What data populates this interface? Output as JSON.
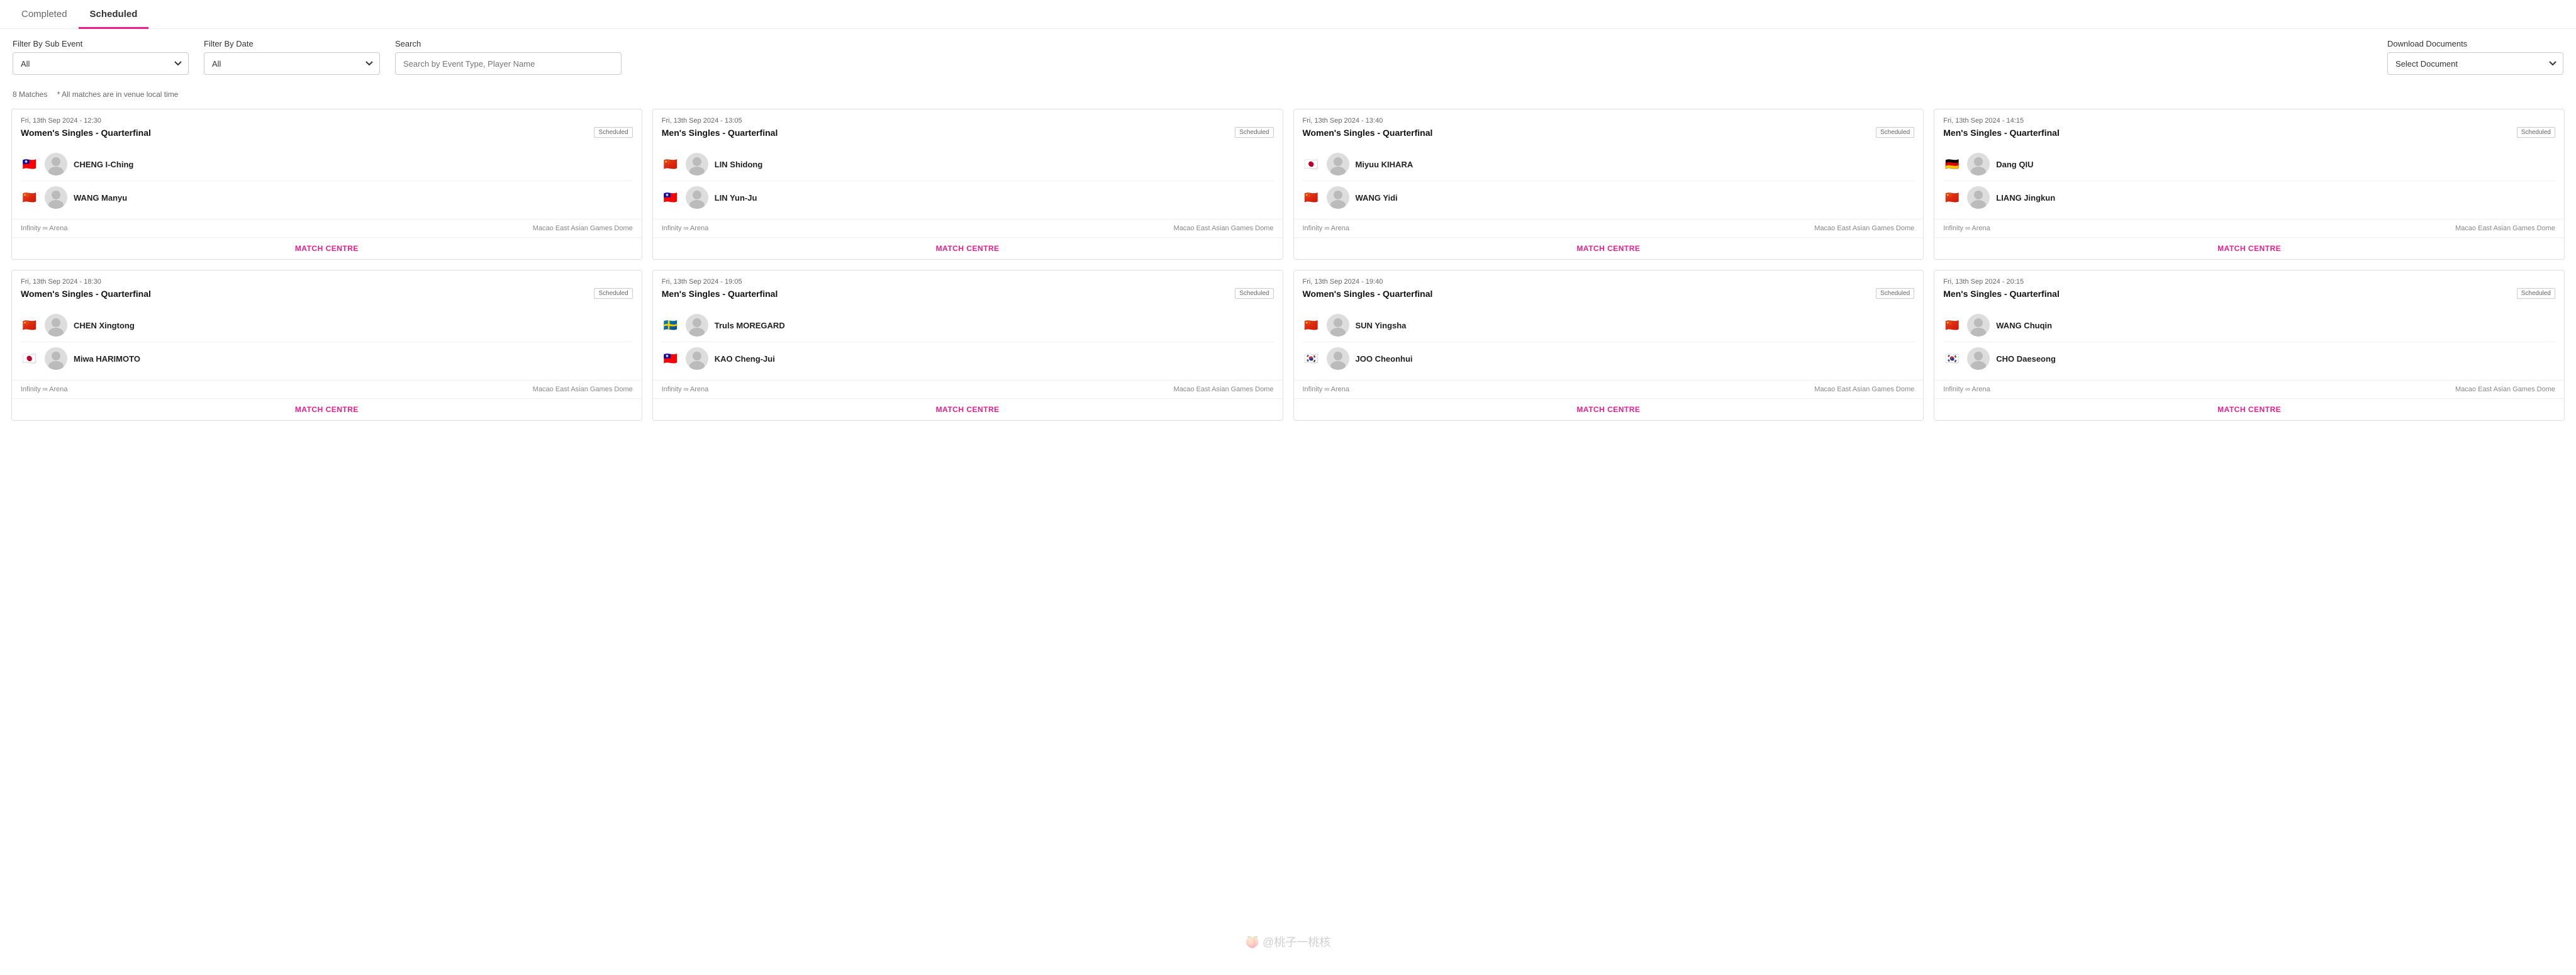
{
  "tabs": [
    {
      "id": "completed",
      "label": "Completed",
      "active": false
    },
    {
      "id": "scheduled",
      "label": "Scheduled",
      "active": true
    }
  ],
  "filters": {
    "sub_event": {
      "label": "Filter By Sub Event",
      "value": "All",
      "options": [
        "All"
      ]
    },
    "date": {
      "label": "Filter By Date",
      "value": "All",
      "options": [
        "All"
      ]
    },
    "search": {
      "label": "Search",
      "placeholder": "Search by Event Type, Player Name",
      "value": ""
    },
    "download": {
      "label": "Download Documents",
      "placeholder": "Select Document",
      "options": [
        "Select Document"
      ]
    }
  },
  "matches_info": {
    "count_label": "8 Matches",
    "note": "* All matches are in venue local time"
  },
  "matches": [
    {
      "datetime": "Fri, 13th Sep 2024 - 12:30",
      "title": "Women's Singles - Quarterfinal",
      "status": "Scheduled",
      "players": [
        {
          "flag": "🇹🇼",
          "name": "CHENG I-Ching"
        },
        {
          "flag": "🇨🇳",
          "name": "WANG Manyu"
        }
      ],
      "venue": "Infinity ∞ Arena",
      "location": "Macao East Asian Games Dome"
    },
    {
      "datetime": "Fri, 13th Sep 2024 - 13:05",
      "title": "Men's Singles - Quarterfinal",
      "status": "Scheduled",
      "players": [
        {
          "flag": "🇨🇳",
          "name": "LIN Shidong"
        },
        {
          "flag": "🇹🇼",
          "name": "LIN Yun-Ju"
        }
      ],
      "venue": "Infinity ∞ Arena",
      "location": "Macao East Asian Games Dome"
    },
    {
      "datetime": "Fri, 13th Sep 2024 - 13:40",
      "title": "Women's Singles - Quarterfinal",
      "status": "Scheduled",
      "players": [
        {
          "flag": "🇯🇵",
          "name": "Miyuu KIHARA"
        },
        {
          "flag": "🇨🇳",
          "name": "WANG Yidi"
        }
      ],
      "venue": "Infinity ∞ Arena",
      "location": "Macao East Asian Games Dome"
    },
    {
      "datetime": "Fri, 13th Sep 2024 - 14:15",
      "title": "Men's Singles - Quarterfinal",
      "status": "Scheduled",
      "players": [
        {
          "flag": "🇩🇪",
          "name": "Dang QIU"
        },
        {
          "flag": "🇨🇳",
          "name": "LIANG Jingkun"
        }
      ],
      "venue": "Infinity ∞ Arena",
      "location": "Macao East Asian Games Dome"
    },
    {
      "datetime": "Fri, 13th Sep 2024 - 18:30",
      "title": "Women's Singles - Quarterfinal",
      "status": "Scheduled",
      "players": [
        {
          "flag": "🇨🇳",
          "name": "CHEN Xingtong"
        },
        {
          "flag": "🇯🇵",
          "name": "Miwa HARIMOTO"
        }
      ],
      "venue": "Infinity ∞ Arena",
      "location": "Macao East Asian Games Dome"
    },
    {
      "datetime": "Fri, 13th Sep 2024 - 19:05",
      "title": "Men's Singles - Quarterfinal",
      "status": "Scheduled",
      "players": [
        {
          "flag": "🇸🇪",
          "name": "Truls MOREGARD"
        },
        {
          "flag": "🇹🇼",
          "name": "KAO Cheng-Jui"
        }
      ],
      "venue": "Infinity ∞ Arena",
      "location": "Macao East Asian Games Dome"
    },
    {
      "datetime": "Fri, 13th Sep 2024 - 19:40",
      "title": "Women's Singles - Quarterfinal",
      "status": "Scheduled",
      "players": [
        {
          "flag": "🇨🇳",
          "name": "SUN Yingsha"
        },
        {
          "flag": "🇰🇷",
          "name": "JOO Cheonhui"
        }
      ],
      "venue": "Infinity ∞ Arena",
      "location": "Macao East Asian Games Dome"
    },
    {
      "datetime": "Fri, 13th Sep 2024 - 20:15",
      "title": "Men's Singles - Quarterfinal",
      "status": "Scheduled",
      "players": [
        {
          "flag": "🇨🇳",
          "name": "WANG Chuqin"
        },
        {
          "flag": "🇰🇷",
          "name": "CHO Daeseong"
        }
      ],
      "venue": "Infinity ∞ Arena",
      "location": "Macao East Asian Games Dome"
    }
  ],
  "match_centre_label": "MATCH CENTRE"
}
